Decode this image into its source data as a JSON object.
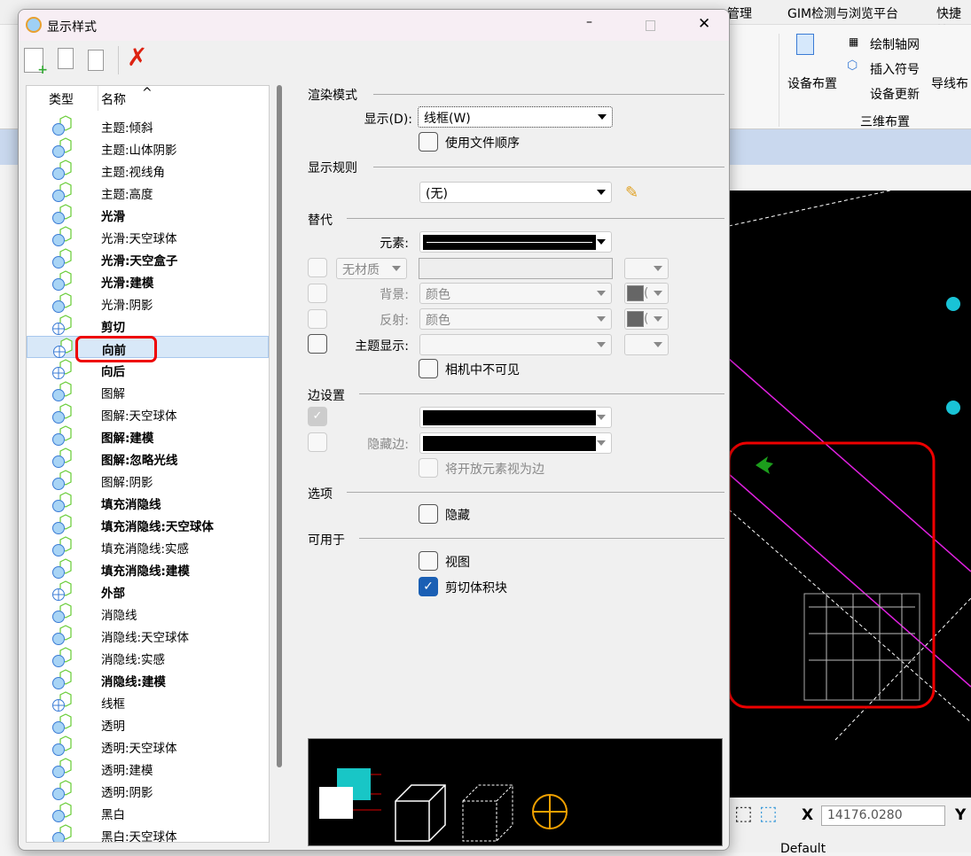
{
  "app": {
    "ribbon_tabs": [
      "管理",
      "GIM检测与浏览平台",
      "快捷绘"
    ],
    "ribbon": {
      "device_layout": "设备布置",
      "draw_axis_grid": "绘制轴网",
      "insert_symbol": "插入符号",
      "device_update": "设备更新",
      "wire_layout": "导线布",
      "group_3d": "三维布置"
    },
    "status": {
      "x_label": "X",
      "x_value": "14176.0280",
      "y_label": "Y",
      "level": "Default"
    }
  },
  "dialog": {
    "title": "显示样式",
    "list": {
      "col_type": "类型",
      "col_name": "名称",
      "sort_indicator": "^",
      "items": [
        {
          "label": "主题:倾斜",
          "bold": false
        },
        {
          "label": "主题:山体阴影",
          "bold": false
        },
        {
          "label": "主题:视线角",
          "bold": false
        },
        {
          "label": "主题:高度",
          "bold": false
        },
        {
          "label": "光滑",
          "bold": true
        },
        {
          "label": "光滑:天空球体",
          "bold": false
        },
        {
          "label": "光滑:天空盒子",
          "bold": true
        },
        {
          "label": "光滑:建模",
          "bold": true
        },
        {
          "label": "光滑:阴影",
          "bold": false
        },
        {
          "label": "剪切",
          "bold": true
        },
        {
          "label": "向前",
          "bold": true,
          "selected": true
        },
        {
          "label": "向后",
          "bold": true
        },
        {
          "label": "图解",
          "bold": false
        },
        {
          "label": "图解:天空球体",
          "bold": false
        },
        {
          "label": "图解:建模",
          "bold": true
        },
        {
          "label": "图解:忽略光线",
          "bold": true
        },
        {
          "label": "图解:阴影",
          "bold": false
        },
        {
          "label": "填充消隐线",
          "bold": true
        },
        {
          "label": "填充消隐线:天空球体",
          "bold": true
        },
        {
          "label": "填充消隐线:实感",
          "bold": false
        },
        {
          "label": "填充消隐线:建模",
          "bold": true
        },
        {
          "label": "外部",
          "bold": true
        },
        {
          "label": "消隐线",
          "bold": false
        },
        {
          "label": "消隐线:天空球体",
          "bold": false
        },
        {
          "label": "消隐线:实感",
          "bold": false
        },
        {
          "label": "消隐线:建模",
          "bold": true
        },
        {
          "label": "线框",
          "bold": false
        },
        {
          "label": "透明",
          "bold": false
        },
        {
          "label": "透明:天空球体",
          "bold": false
        },
        {
          "label": "透明:建模",
          "bold": false
        },
        {
          "label": "透明:阴影",
          "bold": false
        },
        {
          "label": "黑白",
          "bold": false
        },
        {
          "label": "黑白:天空球体",
          "bold": false
        }
      ]
    },
    "render": {
      "section": "渲染模式",
      "display_label": "显示(D):",
      "display_value": "线框(W)",
      "use_file_order": "使用文件顺序"
    },
    "rules": {
      "section": "显示规则",
      "value": "(无)"
    },
    "override": {
      "section": "替代",
      "element_label": "元素:",
      "material": "无材质",
      "background_label": "背景:",
      "background_value": "颜色",
      "reflect_label": "反射:",
      "reflect_value": "颜色",
      "theme_label": "主题显示:",
      "invisible_in_camera": "相机中不可见",
      "paren": "("
    },
    "edges": {
      "section": "边设置",
      "hidden_label": "隐藏边:",
      "open_as_edges": "将开放元素视为边"
    },
    "options": {
      "section": "选项",
      "hidden": "隐藏"
    },
    "usable": {
      "section": "可用于",
      "view": "视图",
      "view_checked": false,
      "clip_volume": "剪切体积块",
      "clip_checked": true
    }
  }
}
